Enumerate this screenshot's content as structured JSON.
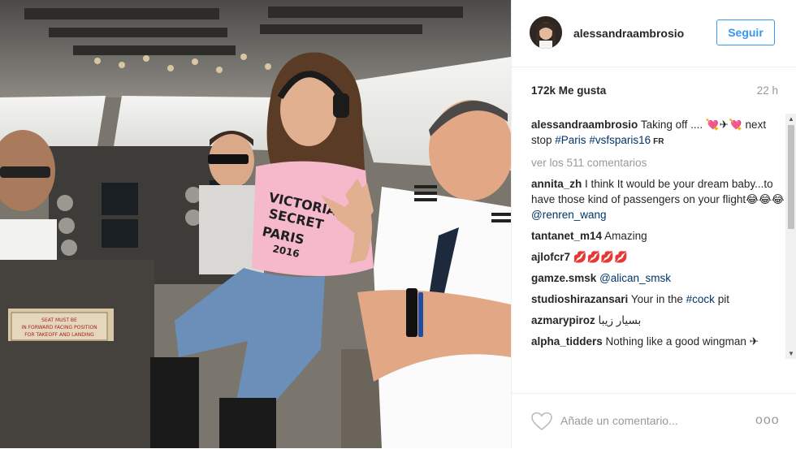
{
  "post": {
    "username": "alessandraambrosio",
    "follow_label": "Seguir",
    "likes": "172k Me gusta",
    "time": "22 h",
    "caption": {
      "user": "alessandraambrosio",
      "text": "Taking off .... 💘✈💘 next stop ",
      "tag1": "#Paris",
      "tag2": "#vsfsparis16",
      "lang": "FR"
    },
    "view_all": "ver los 511 comentarios",
    "comments": [
      {
        "user": "annita_zh",
        "text": "I think It would be your dream baby...to have those kind of passengers on your flight😂😂😂",
        "mention": "@renren_wang"
      },
      {
        "user": "tantanet_m14",
        "text": "Amazing"
      },
      {
        "user": "ajlofcr7",
        "text": "💋💋💋💋"
      },
      {
        "user": "gamze.smsk",
        "text": "",
        "mention": "@alican_smsk"
      },
      {
        "user": "studioshirazansari",
        "text": "Your in the",
        "mention": "#cock",
        "after": "pit"
      },
      {
        "user": "azmarypiroz",
        "text": "بسيار زيبا"
      },
      {
        "user": "alpha_tidders",
        "text": "Nothing like a good wingman ✈"
      }
    ],
    "add_comment_placeholder": "Añade un comentario...",
    "more_options": "ooo"
  },
  "photo_sign": {
    "line1": "SEAT MUST BE",
    "line2": "IN FORWARD FACING POSITION",
    "line3": "FOR TAKEOFF AND LANDING"
  },
  "shirt_text": {
    "line1": "VICTORIA'S",
    "line2": "SECRET",
    "line3": "PARIS",
    "line4": "2016"
  },
  "colors": {
    "accent": "#3897f0",
    "link": "#003569",
    "text": "#262626",
    "muted": "#999999"
  },
  "icons": [
    "heart-icon",
    "more-options-icon",
    "scroll-up-icon",
    "scroll-down-icon"
  ]
}
